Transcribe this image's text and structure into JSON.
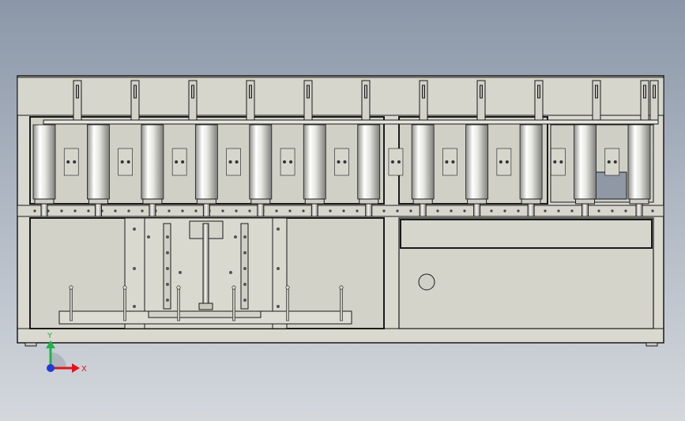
{
  "viewport": {
    "background_top": "#8b97a8",
    "background_bottom": "#d4d8dd",
    "part_fill": "#d9d9d0",
    "edge_color": "#1a1a1a"
  },
  "model": {
    "cylinder_count": 12,
    "clamp_count": 11
  },
  "triad": {
    "x_label": "X",
    "y_label": "Y",
    "x_color": "#e0141e",
    "y_color": "#1fb34a",
    "z_color": "#1e3cd6"
  }
}
